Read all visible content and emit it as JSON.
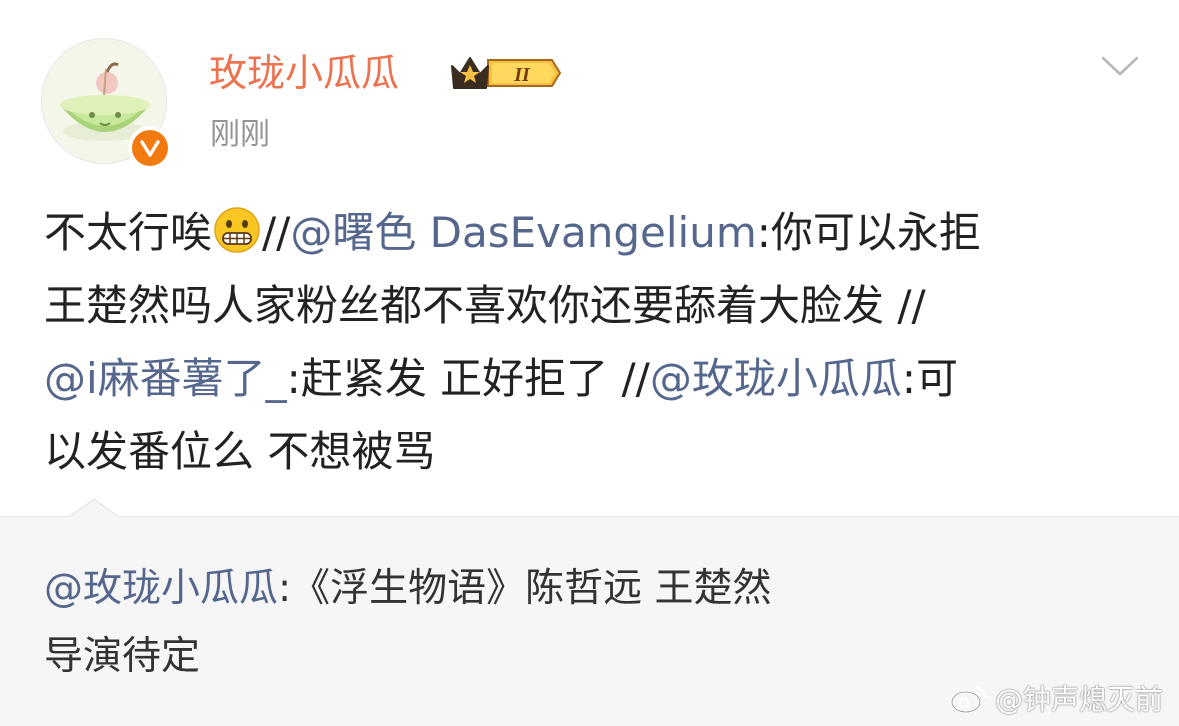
{
  "post": {
    "author": "玫珑小瓜瓜",
    "time": "刚刚",
    "level_badge": "II",
    "avatar": "melon-avatar",
    "verified_icon": "verified-v-icon",
    "menu_icon": "chevron-down-icon",
    "line1_prefix": "不太行唉",
    "line1_emoji": "grimacing-emoji",
    "line1_sep": "//",
    "line1_mention": "@曙色 DasEvangelium",
    "line1_suffix": ":你可以永拒",
    "line2": "王楚然吗人家粉丝都不喜欢你还要舔着大脸发 //",
    "line3_mention1": "@i麻番薯了_",
    "line3_text": ":赶紧发 正好拒了 //",
    "line3_mention2": "@玫珑小瓜瓜",
    "line3_suffix": ":可",
    "line4": "以发番位么 不想被骂"
  },
  "repost": {
    "mention": "@玫珑小瓜瓜",
    "line1_text": ":《浮生物语》陈哲远 王楚然",
    "line2": "导演待定"
  },
  "watermark": {
    "icon": "weibo-logo-icon",
    "text": "@钟声熄灭前"
  },
  "colors": {
    "username": "#eb7350",
    "mention": "#55678d",
    "timestamp": "#939393",
    "verified": "#f27a0f",
    "repost_bg": "#f6f6f6"
  }
}
